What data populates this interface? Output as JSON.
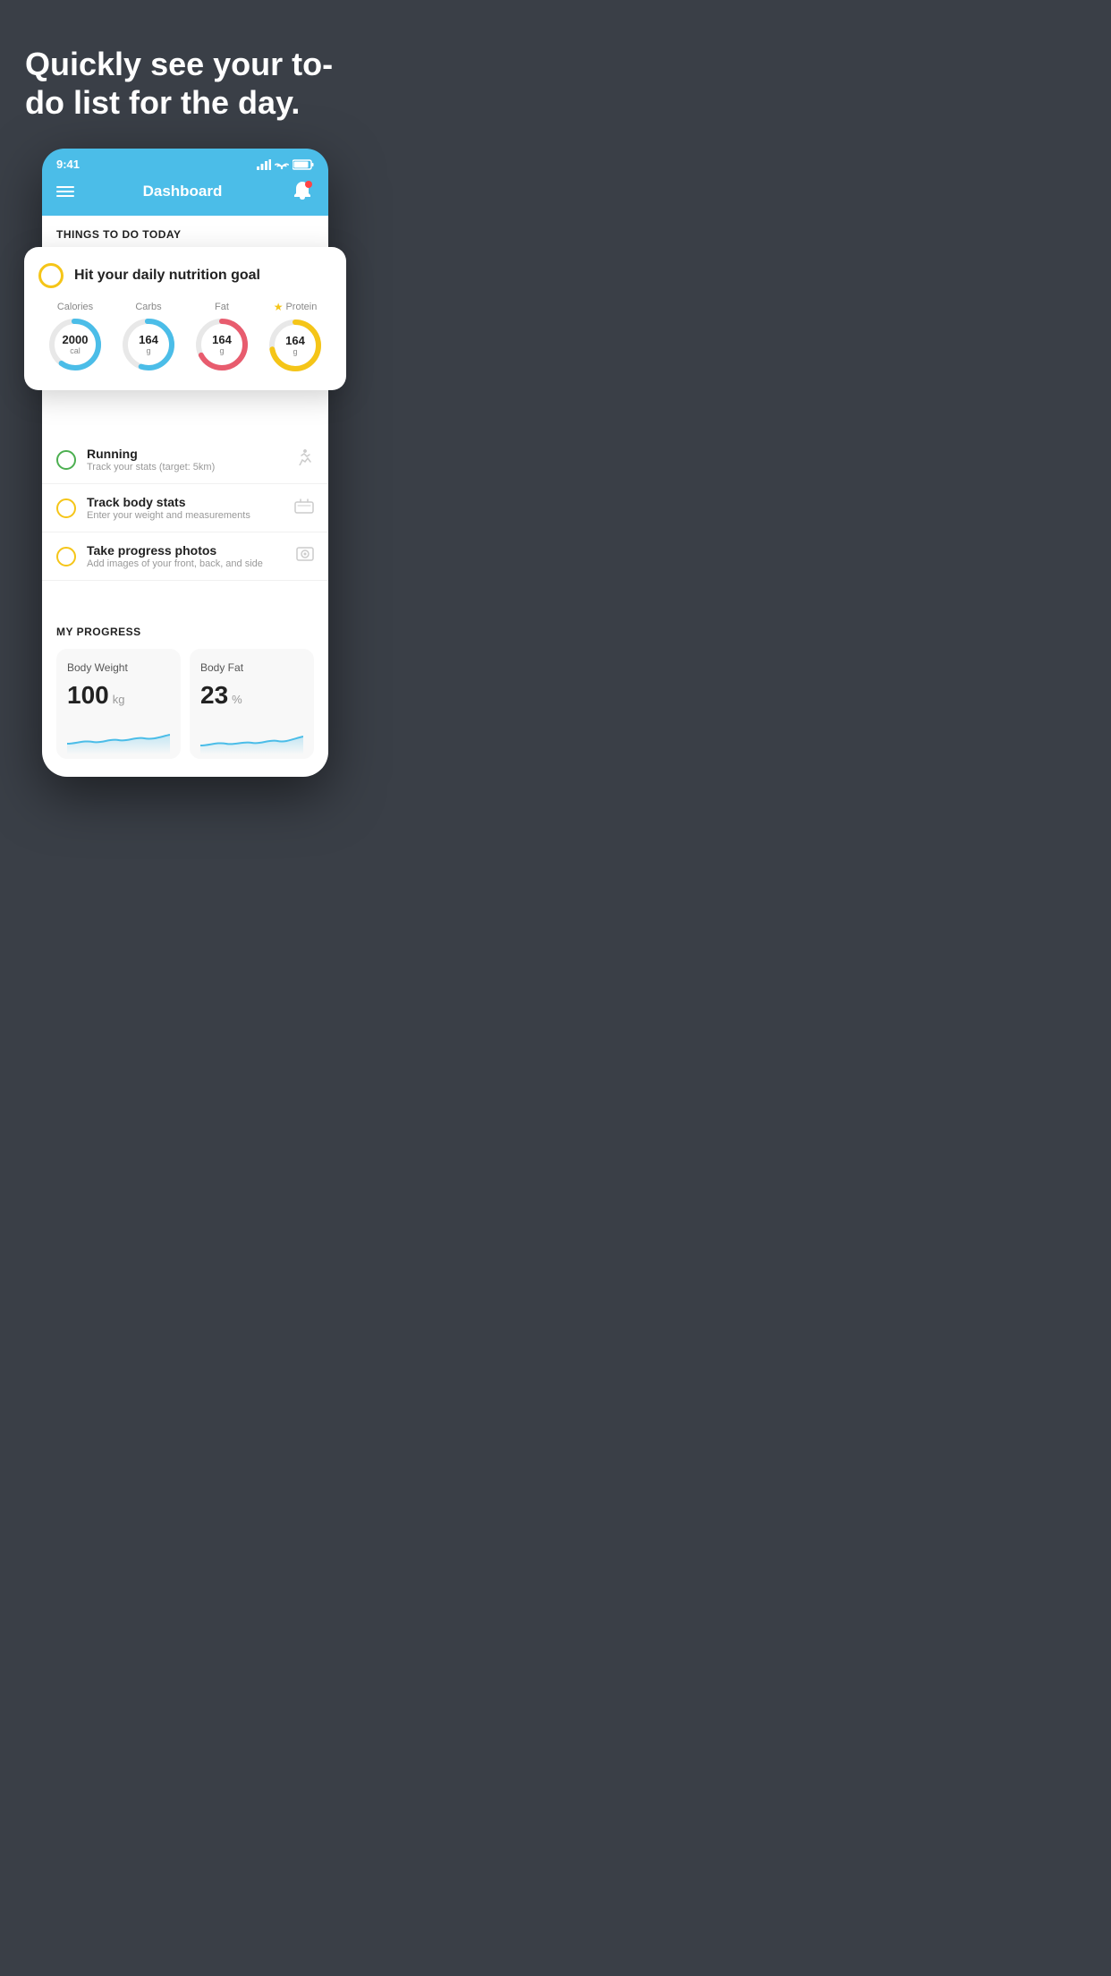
{
  "hero": {
    "title": "Quickly see your to-do list for the day."
  },
  "statusBar": {
    "time": "9:41"
  },
  "nav": {
    "title": "Dashboard"
  },
  "thingsTodo": {
    "sectionHeader": "THINGS TO DO TODAY"
  },
  "nutritionCard": {
    "title": "Hit your daily nutrition goal",
    "items": [
      {
        "label": "Calories",
        "value": "2000",
        "unit": "cal",
        "color": "#4bbde8",
        "pct": 60
      },
      {
        "label": "Carbs",
        "value": "164",
        "unit": "g",
        "color": "#4bbde8",
        "pct": 55
      },
      {
        "label": "Fat",
        "value": "164",
        "unit": "g",
        "color": "#e85c6e",
        "pct": 70
      },
      {
        "label": "Protein",
        "value": "164",
        "unit": "g",
        "color": "#f5c518",
        "pct": 75,
        "star": true
      }
    ]
  },
  "todoItems": [
    {
      "title": "Running",
      "subtitle": "Track your stats (target: 5km)",
      "circleColor": "green",
      "icon": "🏃"
    },
    {
      "title": "Track body stats",
      "subtitle": "Enter your weight and measurements",
      "circleColor": "yellow",
      "icon": "⚖"
    },
    {
      "title": "Take progress photos",
      "subtitle": "Add images of your front, back, and side",
      "circleColor": "yellow",
      "icon": "👤"
    }
  ],
  "progress": {
    "sectionTitle": "MY PROGRESS",
    "cards": [
      {
        "title": "Body Weight",
        "value": "100",
        "unit": "kg"
      },
      {
        "title": "Body Fat",
        "value": "23",
        "unit": "%"
      }
    ]
  }
}
